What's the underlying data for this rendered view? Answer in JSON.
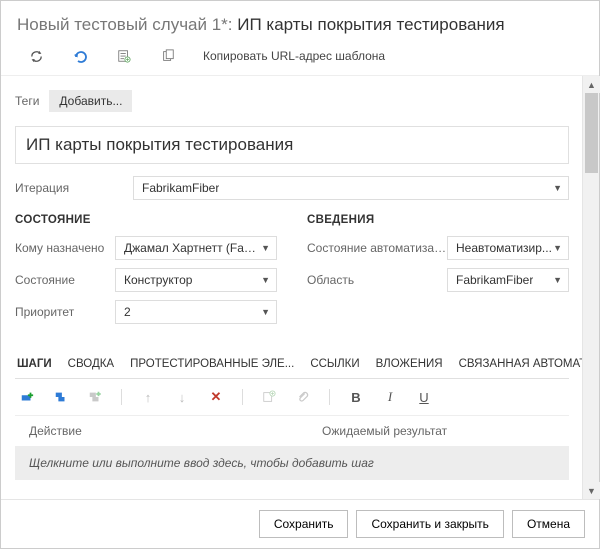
{
  "header": {
    "prefix": "Новый тестовый случай 1*: ",
    "title": "ИП карты покрытия тестирования"
  },
  "toolbar": {
    "copy_link": "Копировать URL-адрес шаблона"
  },
  "tags": {
    "label": "Теги",
    "add": "Добавить..."
  },
  "title_field": {
    "value": "ИП карты покрытия тестирования"
  },
  "iteration": {
    "label": "Итерация",
    "value": "FabrikamFiber"
  },
  "section_state": {
    "heading": "СОСТОЯНИЕ",
    "assigned": {
      "label": "Кому назначено",
      "value": "Джамал Хартнетт (Fabrikam)"
    },
    "state": {
      "label": "Состояние",
      "value": "Конструктор"
    },
    "priority": {
      "label": "Приоритет",
      "value": "2"
    }
  },
  "section_details": {
    "heading": "СВЕДЕНИЯ",
    "automation": {
      "label": "Состояние автоматизации",
      "value": "Неавтоматизир..."
    },
    "area": {
      "label": "Область",
      "value": "FabrikamFiber"
    }
  },
  "tabs": {
    "steps": "ШАГИ",
    "summary": "СВОДКА",
    "tested": "ПРОТЕСТИРОВАННЫЕ ЭЛЕ...",
    "links": "ССЫЛКИ",
    "attachments": "ВЛОЖЕНИЯ",
    "automation": "СВЯЗАННАЯ АВТОМАТИЗАЦИЯ"
  },
  "steps": {
    "col_action": "Действие",
    "col_expected": "Ожидаемый результат",
    "hint": "Щелкните или выполните ввод здесь, чтобы добавить шаг"
  },
  "footer": {
    "save": "Сохранить",
    "save_close": "Сохранить и закрыть",
    "cancel": "Отмена"
  }
}
